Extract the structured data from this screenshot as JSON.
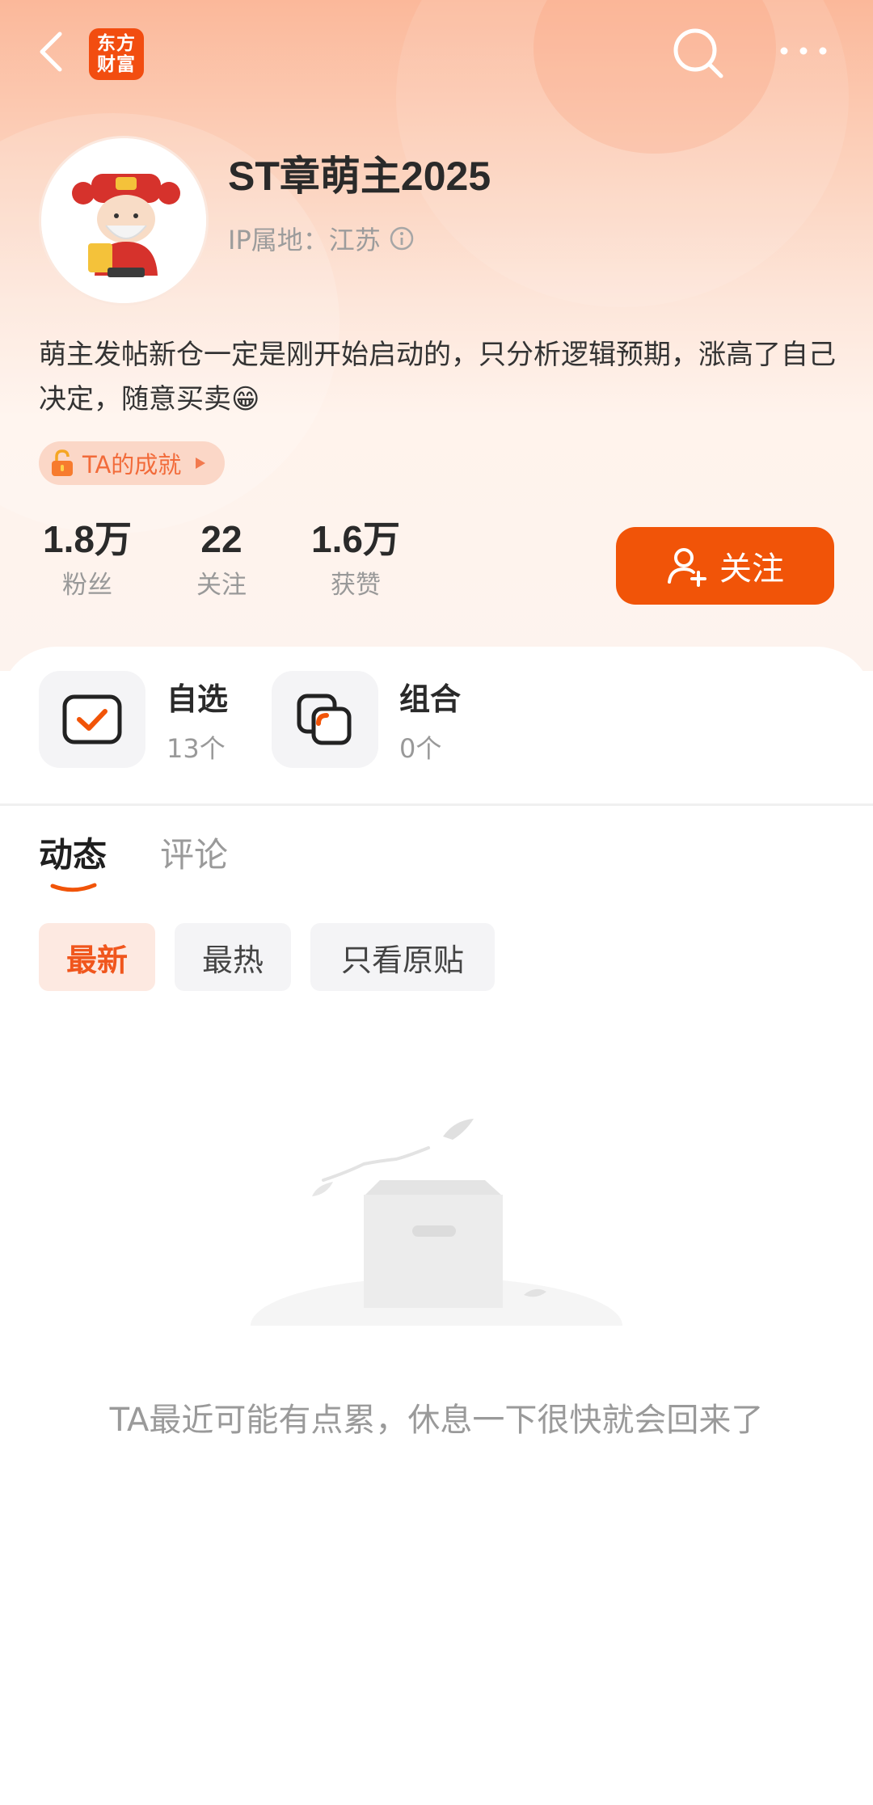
{
  "app": {
    "logo_text_line1": "东方",
    "logo_text_line2": "财富",
    "brand_color": "#f15408"
  },
  "profile": {
    "username": "ST章萌主2025",
    "ip_label": "IP属地：江苏",
    "bio": "萌主发帖新仓一定是刚开始启动的，只分析逻辑预期，涨高了自己决定，随意买卖😁",
    "achievement_label": "TA的成就"
  },
  "stats": [
    {
      "value": "1.8万",
      "label": "粉丝"
    },
    {
      "value": "22",
      "label": "关注"
    },
    {
      "value": "1.6万",
      "label": "获赞"
    }
  ],
  "follow_button": {
    "label": "关注"
  },
  "quick_links": [
    {
      "title": "自选",
      "sub": "13个",
      "icon": "watchlist-check-icon"
    },
    {
      "title": "组合",
      "sub": "0个",
      "icon": "portfolio-icon"
    }
  ],
  "tabs": [
    {
      "label": "动态",
      "active": true
    },
    {
      "label": "评论",
      "active": false
    }
  ],
  "filters": [
    {
      "label": "最新",
      "selected": true
    },
    {
      "label": "最热",
      "selected": false
    },
    {
      "label": "只看原贴",
      "selected": false
    }
  ],
  "empty_state": {
    "message": "TA最近可能有点累，休息一下很快就会回来了"
  }
}
